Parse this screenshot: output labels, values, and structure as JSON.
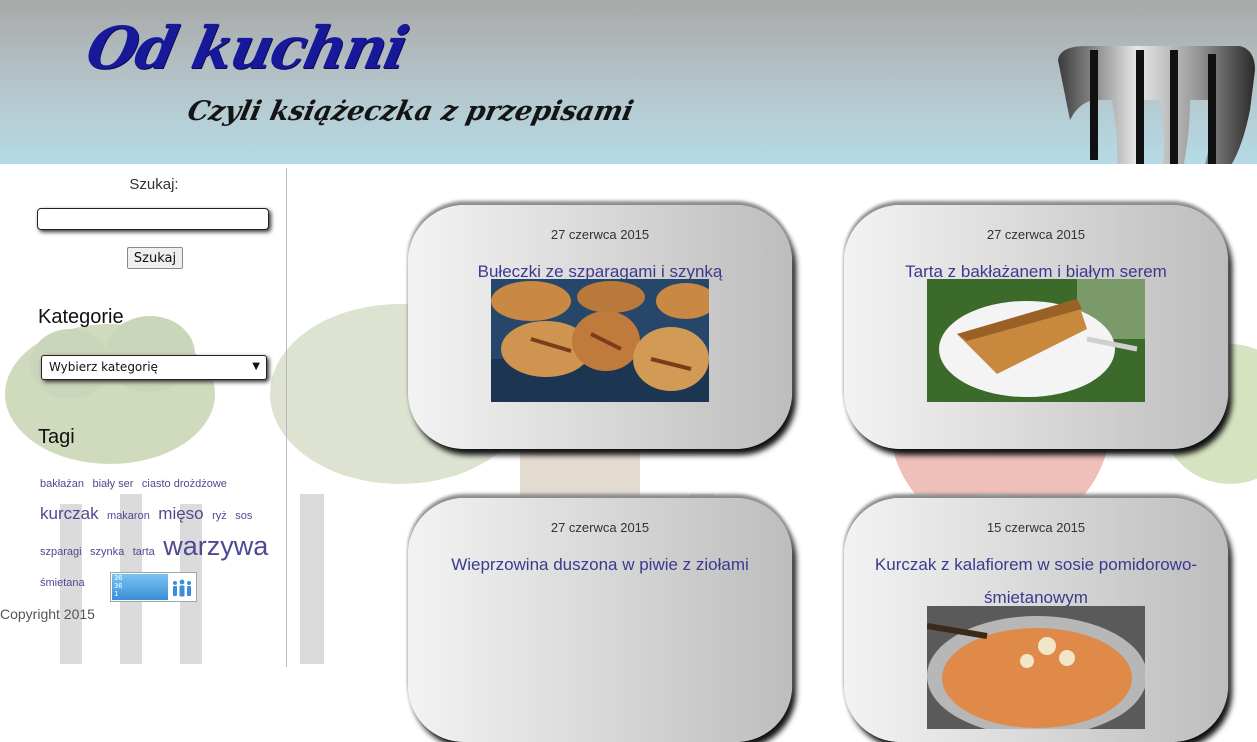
{
  "header": {
    "site_title": "Od kuchni",
    "site_subtitle": "Czyli książeczka z przepisami"
  },
  "sidebar": {
    "search": {
      "label": "Szukaj:",
      "value": "",
      "button_label": "Szukaj"
    },
    "categories": {
      "heading": "Kategorie",
      "selected": "Wybierz kategorię"
    },
    "tags": {
      "heading": "Tagi",
      "items": [
        {
          "label": "bakłażan",
          "size": 11
        },
        {
          "label": "biały ser",
          "size": 11
        },
        {
          "label": "ciasto drożdżowe",
          "size": 11
        },
        {
          "label": "kurczak",
          "size": 17
        },
        {
          "label": "makaron",
          "size": 11
        },
        {
          "label": "mięso",
          "size": 17
        },
        {
          "label": "ryż",
          "size": 11
        },
        {
          "label": "sos",
          "size": 11
        },
        {
          "label": "szparagi",
          "size": 11
        },
        {
          "label": "szynka",
          "size": 11
        },
        {
          "label": "tarta",
          "size": 11
        },
        {
          "label": "warzywa",
          "size": 27
        },
        {
          "label": "śmietana",
          "size": 11
        }
      ]
    },
    "counter": {
      "line1": "36",
      "line2": "36",
      "line3": "1"
    },
    "copyright": "Copyright 2015"
  },
  "posts": [
    {
      "date": "27 czerwca 2015",
      "title": "Bułeczki ze szparagami i szynką"
    },
    {
      "date": "27 czerwca 2015",
      "title": "Tarta z bakłażanem i białym serem"
    },
    {
      "date": "27 czerwca 2015",
      "title": "Wieprzowina duszona w piwie z ziołami"
    },
    {
      "date": "15 czerwca 2015",
      "title": "Kurczak z kalafiorem w sosie pomidorowo-śmietanowym"
    }
  ],
  "colors": {
    "title_blue": "#17189a",
    "link_purple": "#4e4a92",
    "post_title": "#3b3a8f"
  }
}
